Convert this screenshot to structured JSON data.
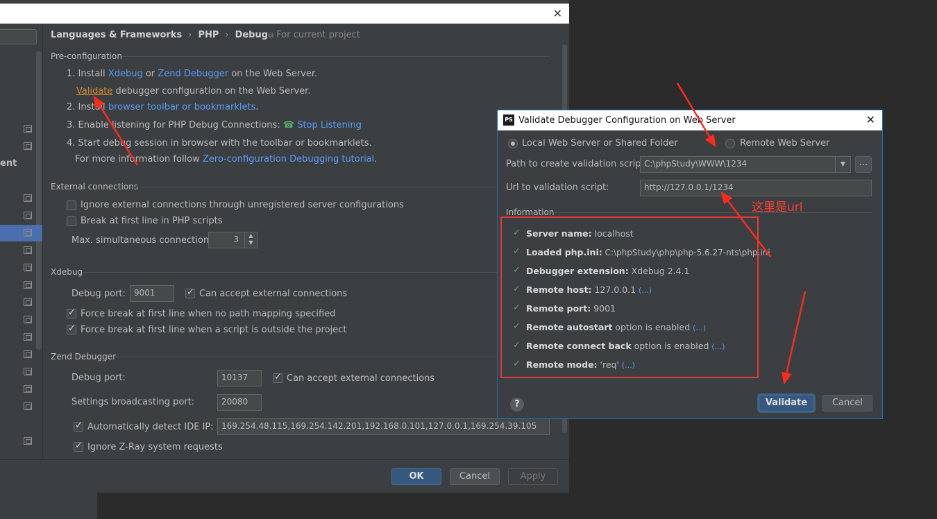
{
  "breadcrumb": {
    "items": [
      "Languages & Frameworks",
      "PHP",
      "Debug"
    ],
    "scope_note": "For current project"
  },
  "sidebar": {
    "visible_label": "ent"
  },
  "pre_config": {
    "title": "Pre-configuration",
    "step1_prefix": "1. Install ",
    "xdebug_link": "Xdebug",
    "or_text": " or ",
    "zend_link": "Zend Debugger",
    "step1_suffix": " on the Web Server.",
    "validate_link": "Validate",
    "validate_suffix": " debugger configuration on the Web Server.",
    "step2_prefix": "2. Install ",
    "step2_link": "browser toolbar or bookmarklets",
    "step2_suffix": ".",
    "step3_prefix": "3. Enable listening for PHP Debug Connections: ",
    "step3_link": "Stop Listening",
    "step4": "4. Start debug session in browser with the toolbar or bookmarklets.",
    "more_info_prefix": "For more information follow ",
    "more_info_link": "Zero-configuration Debugging tutorial",
    "more_info_suffix": "."
  },
  "external": {
    "title": "External connections",
    "ignore_label": "Ignore external connections through unregistered server configurations",
    "ignore_checked": false,
    "break_label": "Break at first line in PHP scripts",
    "break_checked": false,
    "max_label": "Max. simultaneous connections:",
    "max_value": "3"
  },
  "xdebug": {
    "title": "Xdebug",
    "port_label": "Debug port:",
    "port_value": "9001",
    "accept_label": "Can accept external connections",
    "accept_checked": true,
    "force_no_mapping_label": "Force break at first line when no path mapping specified",
    "force_outside_label": "Force break at first line when a script is outside the project"
  },
  "zend": {
    "title": "Zend Debugger",
    "port_label": "Debug port:",
    "port_value": "10137",
    "accept_label": "Can accept external connections",
    "broadcast_label": "Settings broadcasting port:",
    "broadcast_value": "20080",
    "detect_ip_label": "Automatically detect IDE IP:",
    "detect_ip_value": "169.254.48.115,169.254.142.201,192.168.0.101,127.0.0.1,169.254.39.105",
    "zray_label": "Ignore Z-Ray system requests"
  },
  "footer": {
    "ok": "OK",
    "cancel": "Cancel",
    "apply": "Apply"
  },
  "dialog": {
    "app_icon": "PS",
    "title": "Validate Debugger Configuration on Web Server",
    "local_label": "Local Web Server or Shared Folder",
    "remote_label": "Remote Web Server",
    "selected_mode": "local",
    "path_label": "Path to create validation script:",
    "path_value": "C:\\phpStudy\\WWW\\1234",
    "browse_label": "...",
    "url_label": "Url to validation script:",
    "url_value": "http://127.0.0.1/1234",
    "info_title": "Information",
    "info": [
      {
        "key": "Server name:",
        "value": " localhost",
        "more": ""
      },
      {
        "key": "Loaded php.ini:",
        "value": " C:\\phpStudy\\php\\php-5.6.27-nts\\php.ini",
        "more": ""
      },
      {
        "key": "Debugger extension:",
        "value": " Xdebug 2.4.1",
        "more": ""
      },
      {
        "key": "Remote host:",
        "value": " 127.0.0.1 ",
        "more": "(...)"
      },
      {
        "key": "Remote port:",
        "value": " 9001",
        "more": ""
      },
      {
        "key": "Remote autostart",
        "value": " option is enabled ",
        "more": "(...)"
      },
      {
        "key": "Remote connect back",
        "value": " option is enabled ",
        "more": "(...)"
      },
      {
        "key": "Remote mode:",
        "value": " 'req' ",
        "more": "(...)"
      }
    ],
    "help": "?",
    "validate_btn": "Validate",
    "cancel_btn": "Cancel"
  },
  "annotation": {
    "url_note": "这里是url",
    "color": "#ff3b2f"
  },
  "colors": {
    "panel": "#3c3f41",
    "link": "#589df6",
    "primary": "#365880",
    "ok_check": "#59a869"
  }
}
